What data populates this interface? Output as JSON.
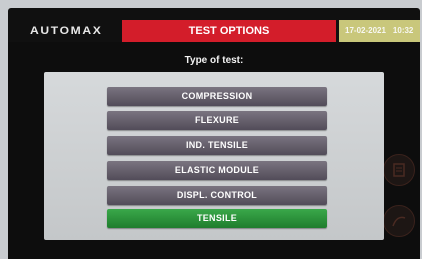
{
  "header": {
    "logo": "AUTOMAX",
    "title": "TEST OPTIONS",
    "date": "17-02-2021",
    "time": "10:32"
  },
  "dialog": {
    "prompt": "Type of test:",
    "options": [
      {
        "label": "COMPRESSION",
        "selected": false
      },
      {
        "label": "FLEXURE",
        "selected": false
      },
      {
        "label": "IND. TENSILE",
        "selected": false
      },
      {
        "label": "ELASTIC MODULE",
        "selected": false
      },
      {
        "label": "DISPL. CONTROL",
        "selected": false
      },
      {
        "label": "TENSILE",
        "selected": true
      }
    ]
  },
  "side_buttons": [
    {
      "icon": "document-icon"
    },
    {
      "icon": "curve-icon"
    }
  ],
  "colors": {
    "title_bar": "#d31d2a",
    "date_bar": "#c9c77b",
    "option_bg": "#5f5966",
    "selected_option_bg": "#2a9a3b"
  }
}
